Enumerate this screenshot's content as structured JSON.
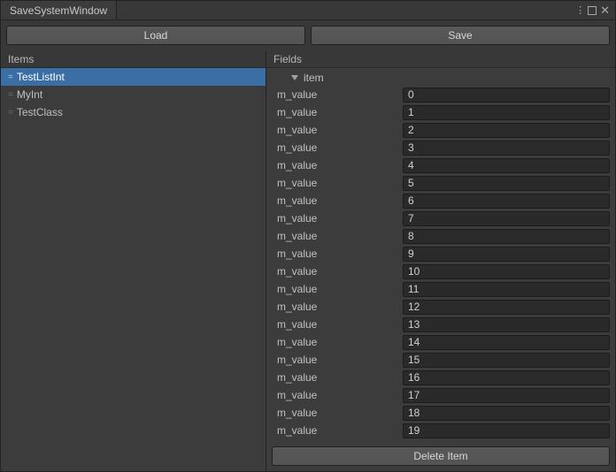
{
  "window": {
    "title": "SaveSystemWindow"
  },
  "toolbar": {
    "load_label": "Load",
    "save_label": "Save"
  },
  "panels": {
    "items_header": "Items",
    "fields_header": "Fields"
  },
  "items": [
    {
      "label": "TestListInt",
      "selected": true
    },
    {
      "label": "MyInt",
      "selected": false
    },
    {
      "label": "TestClass",
      "selected": false
    }
  ],
  "foldout": {
    "label": "item"
  },
  "fields": [
    {
      "label": "m_value",
      "value": "0"
    },
    {
      "label": "m_value",
      "value": "1"
    },
    {
      "label": "m_value",
      "value": "2"
    },
    {
      "label": "m_value",
      "value": "3"
    },
    {
      "label": "m_value",
      "value": "4"
    },
    {
      "label": "m_value",
      "value": "5"
    },
    {
      "label": "m_value",
      "value": "6"
    },
    {
      "label": "m_value",
      "value": "7"
    },
    {
      "label": "m_value",
      "value": "8"
    },
    {
      "label": "m_value",
      "value": "9"
    },
    {
      "label": "m_value",
      "value": "10"
    },
    {
      "label": "m_value",
      "value": "11"
    },
    {
      "label": "m_value",
      "value": "12"
    },
    {
      "label": "m_value",
      "value": "13"
    },
    {
      "label": "m_value",
      "value": "14"
    },
    {
      "label": "m_value",
      "value": "15"
    },
    {
      "label": "m_value",
      "value": "16"
    },
    {
      "label": "m_value",
      "value": "17"
    },
    {
      "label": "m_value",
      "value": "18"
    },
    {
      "label": "m_value",
      "value": "19"
    }
  ],
  "actions": {
    "delete_label": "Delete Item"
  }
}
